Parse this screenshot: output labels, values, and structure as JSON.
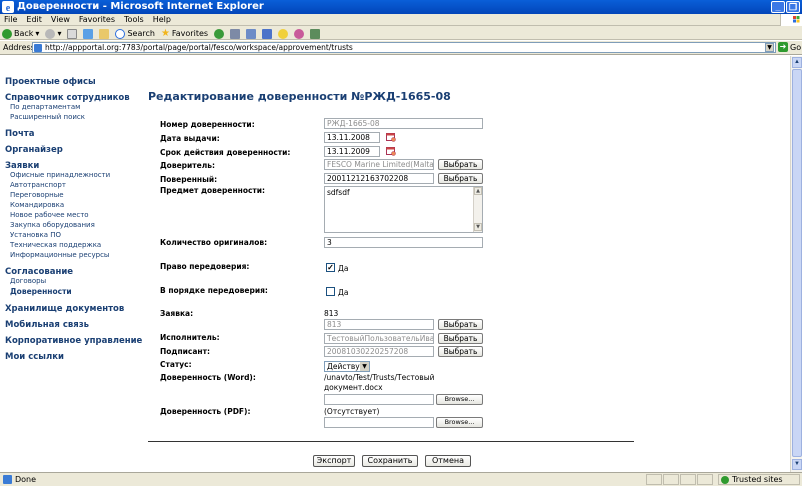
{
  "window": {
    "title": "Доверенности - Microsoft Internet Explorer",
    "buttons": [
      "_",
      "❐"
    ]
  },
  "menu": [
    "File",
    "Edit",
    "View",
    "Favorites",
    "Tools",
    "Help"
  ],
  "toolbar": {
    "back": "Back",
    "search": "Search",
    "favorites": "Favorites"
  },
  "address": {
    "label": "Address",
    "url": "http://appportal.org:7783/portal/page/portal/fesco/workspace/approvement/trusts",
    "go": "Go"
  },
  "sidebar": {
    "offices": "Проектные офисы",
    "directory": "Справочник сотрудников",
    "by_department": "По департаментам",
    "advanced_search": "Расширенный поиск",
    "mail": "Почта",
    "organizer": "Органайзер",
    "requests": "Заявки",
    "requests_items": [
      "Офисные принадлежности",
      "Автотранспорт",
      "Переговорные",
      "Командировка",
      "Новое рабочее место",
      "Закупка оборудования",
      "Установка ПО",
      "Техническая поддержка",
      "Информационные ресурсы"
    ],
    "approval": "Согласование",
    "contracts": "Договоры",
    "trusts": "Доверенности",
    "doc_storage": "Хранилище документов",
    "mobile": "Мобильная связь",
    "corporate": "Корпоративное управление",
    "my_links": "Мои ссылки"
  },
  "form": {
    "title": "Редактирование доверенности №РЖД-1665-08",
    "number_label": "Номер доверенности:",
    "number_value": "РЖД-1665-08",
    "issue_date_label": "Дата выдачи:",
    "issue_date_value": "13.11.2008",
    "validity_label": "Срок действия доверенности:",
    "validity_value": "13.11.2009",
    "principal_label": "Доверитель:",
    "principal_value": "FESCO Marine Limited(Malta)",
    "attorney_label": "Поверенный:",
    "attorney_value": "20011212163702208",
    "subject_label": "Предмет доверенности:",
    "subject_value": "sdfsdf",
    "originals_label": "Количество оригиналов:",
    "originals_value": "3",
    "resubst_label": "Право передоверия:",
    "resubst_checked": true,
    "resubst_text": "Да",
    "by_resubst_label": "В порядке передоверия:",
    "by_resubst_checked": false,
    "by_resubst_text": "Да",
    "request_label": "Заявка:",
    "request_text": "813",
    "request_value": "813",
    "executor_label": "Исполнитель:",
    "executor_value": "ТестовыйПользовательИванов",
    "signatory_label": "Подписант:",
    "signatory_value": "20081030220257208",
    "status_label": "Статус:",
    "status_value": "Действует",
    "word_label": "Доверенность (Word):",
    "word_path_1": "/unavto/Test/Trusts/Тестовый",
    "word_path_2": "документ.docx",
    "pdf_label": "Доверенность (PDF):",
    "pdf_value": "(Отсутствует)",
    "select_btn": "Выбрать",
    "browse_btn": "Browse..."
  },
  "actions": {
    "export": "Экспорт",
    "save": "Сохранить",
    "cancel": "Отмена"
  },
  "status": {
    "left": "Done",
    "zone": "Trusted sites"
  }
}
